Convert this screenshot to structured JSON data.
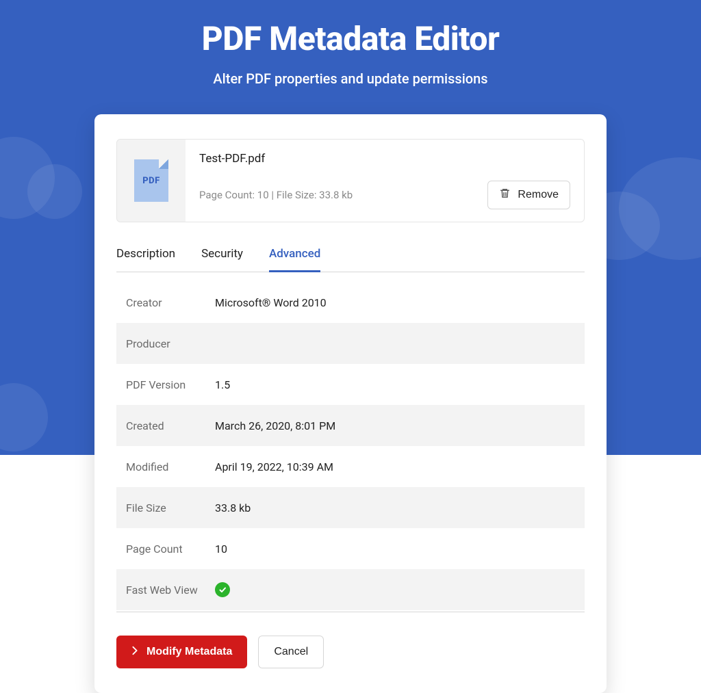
{
  "hero": {
    "title": "PDF Metadata Editor",
    "subtitle": "Alter PDF properties and update permissions"
  },
  "file": {
    "icon_label": "PDF",
    "name": "Test-PDF.pdf",
    "meta": "Page Count: 10  |  File Size: 33.8 kb",
    "remove_label": "Remove"
  },
  "tabs": {
    "description": "Description",
    "security": "Security",
    "advanced": "Advanced",
    "active": "advanced"
  },
  "props": {
    "creator": {
      "label": "Creator",
      "value": "Microsoft® Word 2010"
    },
    "producer": {
      "label": "Producer",
      "value": ""
    },
    "pdf_version": {
      "label": "PDF Version",
      "value": "1.5"
    },
    "created": {
      "label": "Created",
      "value": "March 26, 2020, 8:01 PM"
    },
    "modified": {
      "label": "Modified",
      "value": "April 19, 2022, 10:39 AM"
    },
    "file_size": {
      "label": "File Size",
      "value": "33.8 kb"
    },
    "page_count": {
      "label": "Page Count",
      "value": "10"
    },
    "fast_web_view": {
      "label": "Fast Web View",
      "value": true
    }
  },
  "actions": {
    "modify_label": "Modify Metadata",
    "cancel_label": "Cancel"
  }
}
